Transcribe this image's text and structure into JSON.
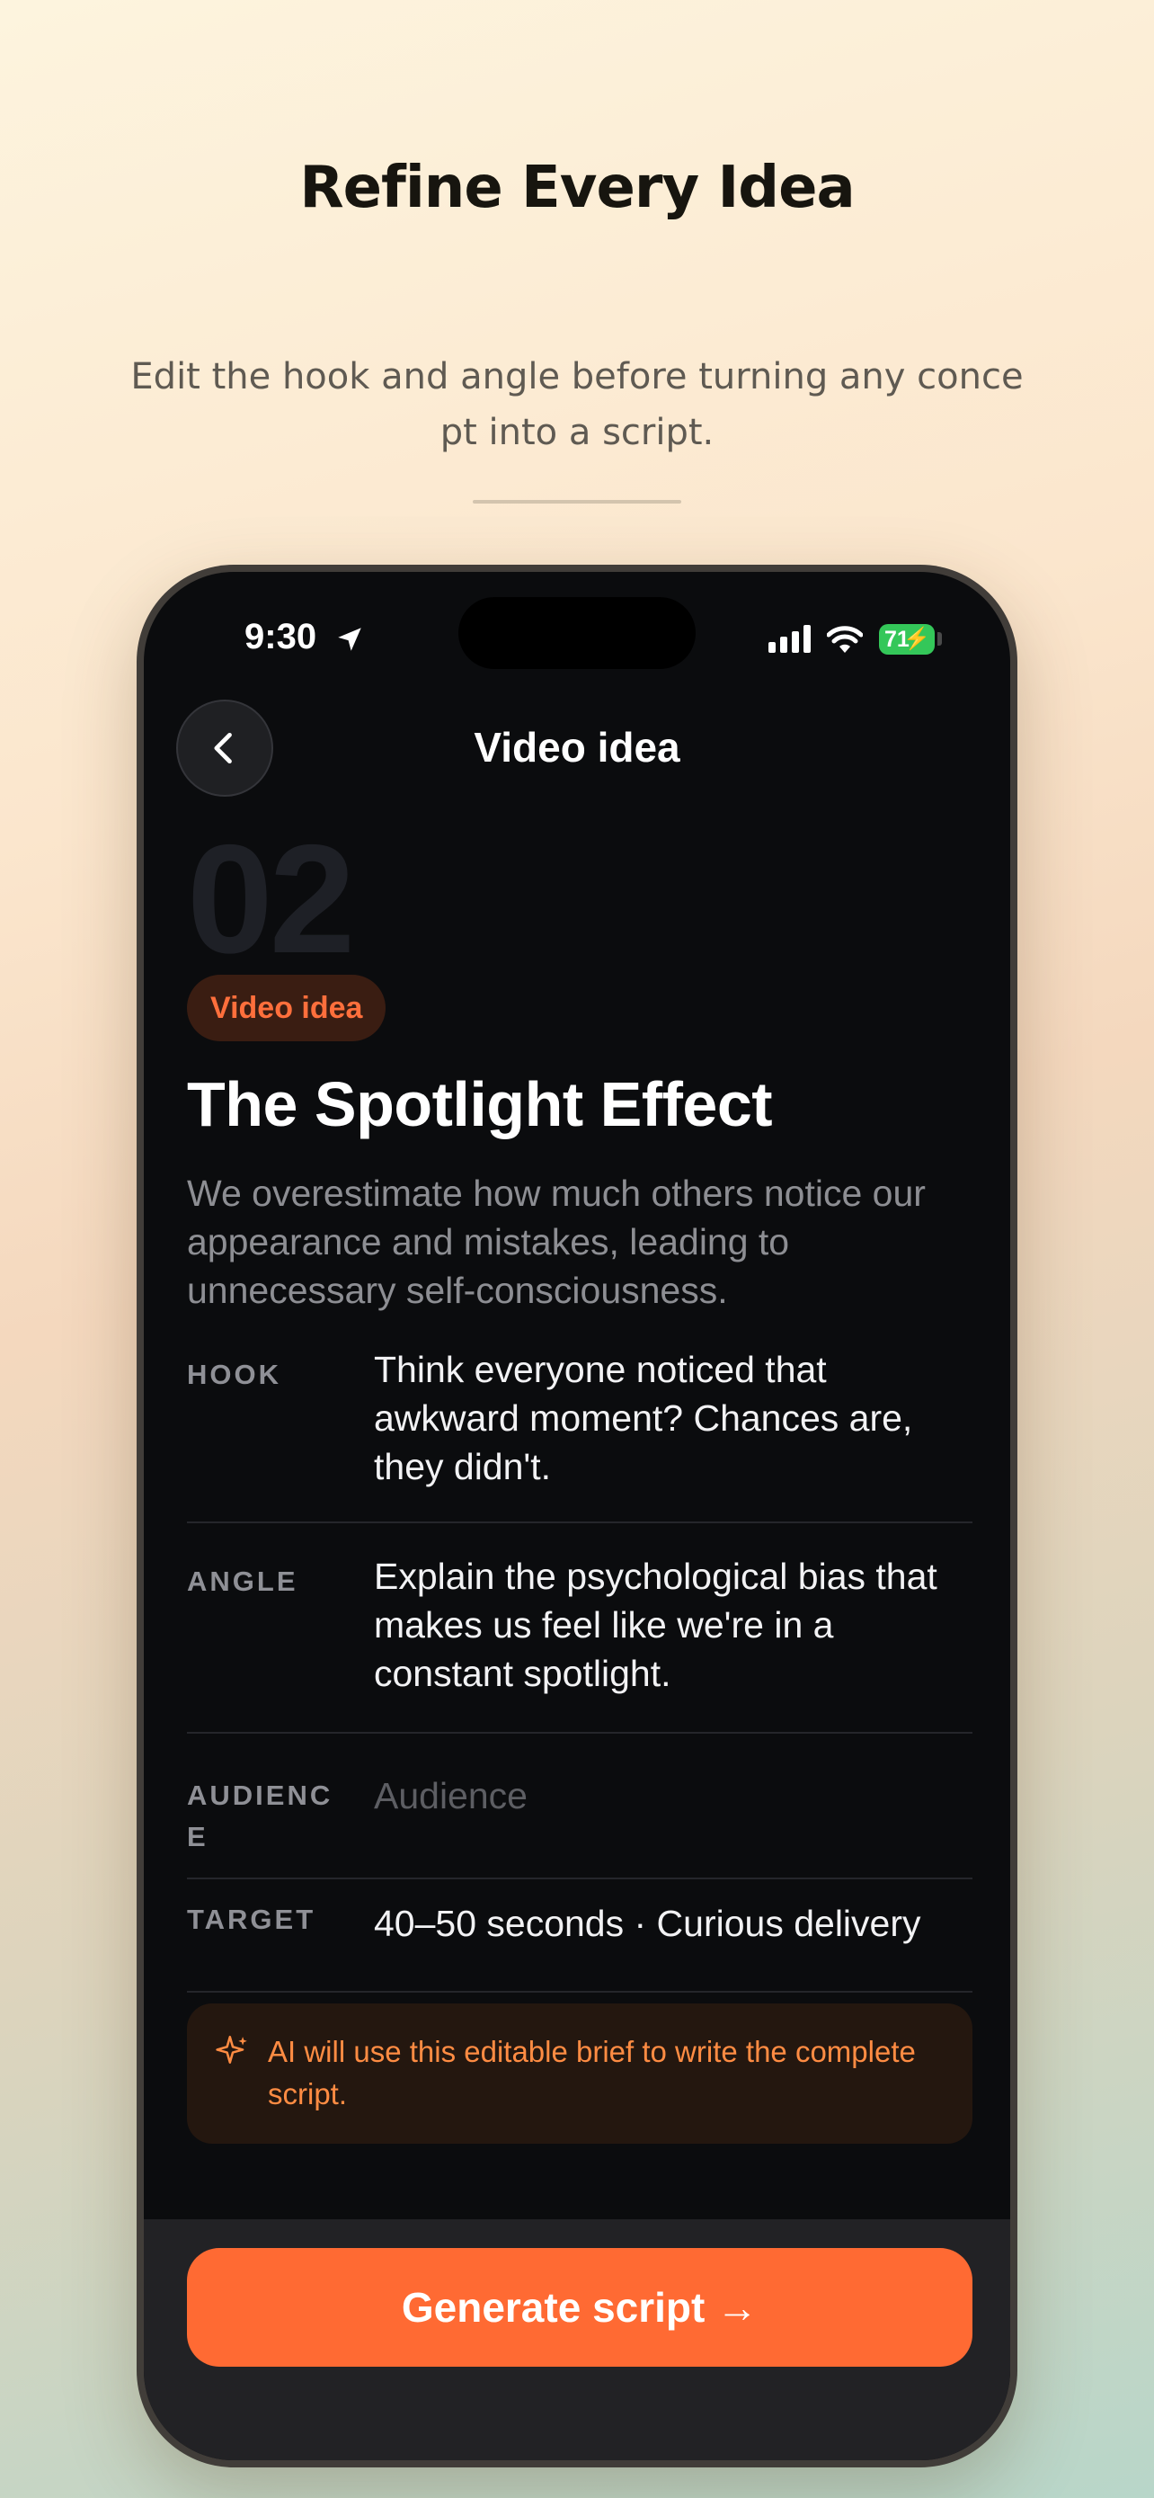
{
  "page": {
    "headline": "Refine Every Idea",
    "subhead": "Edit the hook and angle before turning any concept into a script."
  },
  "status_bar": {
    "time": "9:30",
    "battery": "71",
    "icons": [
      "location-arrow-icon",
      "cellular-signal-icon",
      "wifi-icon",
      "battery-icon"
    ]
  },
  "nav": {
    "back_icon": "chevron-left-icon",
    "title": "Video idea"
  },
  "idea": {
    "number": "02",
    "tag": "Video idea",
    "title": "The Spotlight Effect",
    "description": "We overestimate how much others notice our appearance and mistakes, leading to unnecessary self-consciousness."
  },
  "brief": {
    "hook": {
      "label": "HOOK",
      "value": "Think everyone noticed that awkward moment? Chances are, they didn't."
    },
    "angle": {
      "label": "ANGLE",
      "value": "Explain the psychological bias that makes us feel like we're in a constant spotlight."
    },
    "audience": {
      "label": "AUDIENCE",
      "value": "",
      "placeholder": "Audience"
    },
    "target": {
      "label": "TARGET",
      "value": "40–50 seconds · Curious delivery"
    }
  },
  "ai_note": {
    "icon": "sparkle-icon",
    "text": "AI will use this editable brief to write the complete script."
  },
  "actions": {
    "generate_label": "Generate script →"
  },
  "colors": {
    "accent": "#ff6a33",
    "tag_text": "#ff6f3c",
    "note_text": "#ff8c43",
    "screen_bg": "#0b0c0e",
    "battery": "#34c759"
  }
}
